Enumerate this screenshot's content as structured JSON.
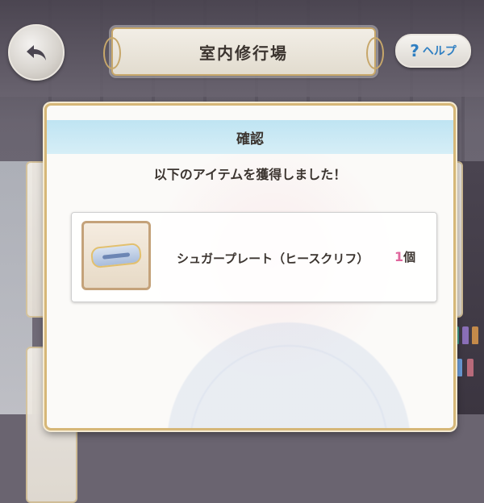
{
  "header": {
    "title": "室内修行場",
    "help_label": "ヘルプ",
    "help_glyph": "?"
  },
  "dialog": {
    "title": "確認",
    "message": "以下のアイテムを獲得しました！",
    "item": {
      "name": "シュガープレート（ヒースクリフ）",
      "quantity": "1",
      "unit": "個"
    }
  },
  "colors": {
    "gold_border": "#d6b778",
    "header_band": "#bfe4f2",
    "help_text": "#2f7fc2",
    "quantity": "#e0679d"
  },
  "icons": [
    "back-arrow-icon",
    "sugar-plate-icon"
  ]
}
